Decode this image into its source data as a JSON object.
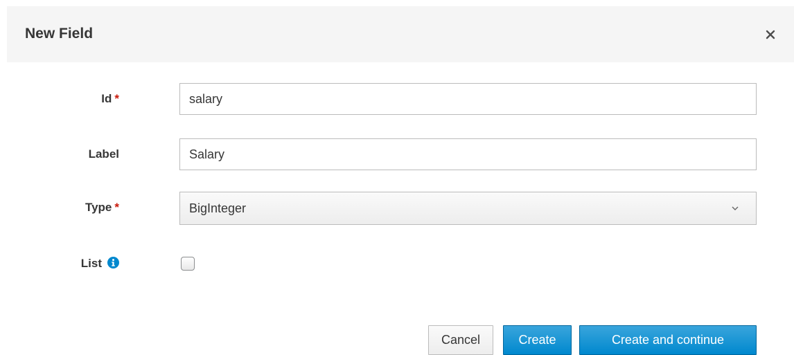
{
  "dialog": {
    "title": "New Field",
    "close_icon": "close-icon"
  },
  "form": {
    "id": {
      "label": "Id",
      "required_mark": "*",
      "value": "salary"
    },
    "label": {
      "label": "Label",
      "value": "Salary"
    },
    "type": {
      "label": "Type",
      "required_mark": "*",
      "selected": "BigInteger",
      "caret_icon": "chevron-down-icon"
    },
    "list": {
      "label": "List",
      "info_icon": "info-icon",
      "checked": false
    }
  },
  "buttons": {
    "cancel": "Cancel",
    "create": "Create",
    "create_continue": "Create and continue"
  },
  "colors": {
    "primary": "#0088ce",
    "required": "#c9190b",
    "header_bg": "#f5f5f5"
  }
}
